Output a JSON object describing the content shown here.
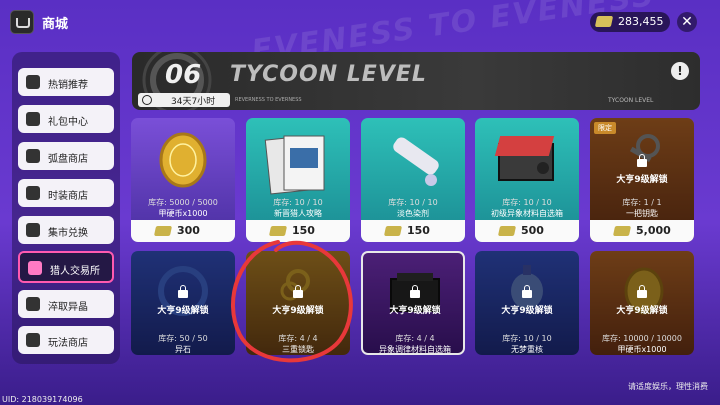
{
  "header": {
    "title": "商城",
    "currency_value": "283,455"
  },
  "sidebar": {
    "items": [
      {
        "label": "热销推荐",
        "icon": "thumbs-up-icon"
      },
      {
        "label": "礼包中心",
        "icon": "gift-icon"
      },
      {
        "label": "弧盘商店",
        "icon": "disc-icon"
      },
      {
        "label": "时装商店",
        "icon": "hanger-icon"
      },
      {
        "label": "集市兑换",
        "icon": "cart-icon"
      },
      {
        "label": "猎人交易所",
        "icon": "scales-icon"
      },
      {
        "label": "淬取异晶",
        "icon": "crystal-icon"
      },
      {
        "label": "玩法商店",
        "icon": "bag-icon"
      }
    ],
    "active_index": 5
  },
  "banner": {
    "number": "06",
    "title": "TYCOON LEVEL",
    "time_left": "34天7小时",
    "small_text_left": "REVERNESS TO EVERNESS",
    "small_text_right": "TYCOON LEVEL"
  },
  "row1": [
    {
      "stock": "库存: 5000 / 5000",
      "name": "甲硬币x1000",
      "price": "300"
    },
    {
      "stock": "库存: 10 / 10",
      "name": "新晋猎人攻略",
      "price": "150"
    },
    {
      "stock": "库存: 10 / 10",
      "name": "淡色染剂",
      "price": "150"
    },
    {
      "stock": "库存: 10 / 10",
      "name": "初级异象材料自选箱",
      "price": "500"
    },
    {
      "tag": "限定",
      "unlock": "大亨9级解锁",
      "stock": "库存: 1 / 1",
      "name": "一把钥匙",
      "price": "5,000"
    }
  ],
  "row2": [
    {
      "unlock": "大亨9级解锁",
      "stock": "库存: 50 / 50",
      "name": "异石"
    },
    {
      "unlock": "大亨9级解锁",
      "stock": "库存: 4 / 4",
      "name": "三重锁匙"
    },
    {
      "unlock": "大亨9级解锁",
      "stock": "库存: 4 / 4",
      "name": "异象调律材料自选箱"
    },
    {
      "unlock": "大亨9级解锁",
      "stock": "库存: 10 / 10",
      "name": "无梦重核"
    },
    {
      "unlock": "大亨9级解锁",
      "stock": "库存: 10000 / 10000",
      "name": "甲硬币x1000"
    }
  ],
  "footer": {
    "uid": "UID: 218039174096",
    "note": "请适度娱乐，理性消费"
  },
  "watermark": "EVENESS TO EVENESS",
  "colors": {
    "accent_pink": "#ff5ab0",
    "annotation_red": "#e8383a"
  }
}
